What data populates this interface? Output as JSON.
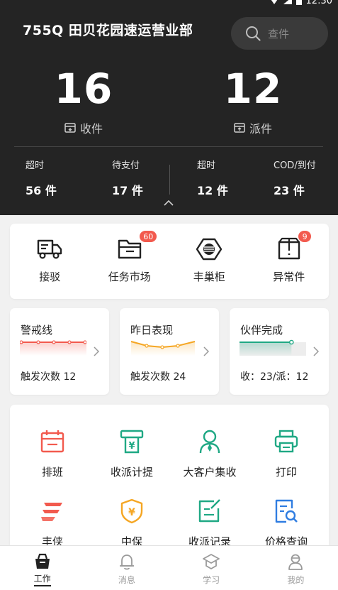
{
  "status_bar": {
    "time": "12:30"
  },
  "header": {
    "station": "755Q 田贝花园速运营业部",
    "search_placeholder": "查件",
    "receive": {
      "count": "16",
      "label": "收件"
    },
    "dispatch": {
      "count": "12",
      "label": "派件"
    },
    "sub_stats": [
      {
        "title": "超时",
        "value": "56 件"
      },
      {
        "title": "待支付",
        "value": "17 件"
      },
      {
        "title": "超时",
        "value": "12 件"
      },
      {
        "title": "COD/到付",
        "value": "23 件"
      }
    ]
  },
  "quick_actions": [
    {
      "label": "接驳",
      "icon": "truck-icon"
    },
    {
      "label": "任务市场",
      "icon": "folder-icon",
      "badge": "60"
    },
    {
      "label": "丰巢柜",
      "icon": "locker-icon"
    },
    {
      "label": "异常件",
      "icon": "exception-box-icon",
      "badge": "9"
    }
  ],
  "metrics": [
    {
      "title": "警戒线",
      "value": "触发次数 12",
      "color": "#f25a4e"
    },
    {
      "title": "昨日表现",
      "value": "触发次数 24",
      "color": "#f5a623"
    },
    {
      "title": "伙伴完成",
      "value": "收：23/派：12",
      "color": "#1fa884",
      "progress": 0.78
    }
  ],
  "tools": [
    {
      "label": "排班",
      "icon": "calendar-icon",
      "color": "#f25a4e"
    },
    {
      "label": "收派计提",
      "icon": "atm-icon",
      "color": "#1fa884"
    },
    {
      "label": "大客户集收",
      "icon": "person-icon",
      "color": "#1fa884"
    },
    {
      "label": "打印",
      "icon": "printer-icon",
      "color": "#1fa884"
    },
    {
      "label": "丰侠",
      "icon": "feng-logo-icon",
      "color": "#f25a4e"
    },
    {
      "label": "中保",
      "icon": "yuan-shield-icon",
      "color": "#f5a623"
    },
    {
      "label": "收派记录",
      "icon": "edit-note-icon",
      "color": "#1fa884"
    },
    {
      "label": "价格查询",
      "icon": "doc-search-icon",
      "color": "#2f7de1"
    }
  ],
  "tabbar": [
    {
      "label": "工作",
      "icon": "work-bag-icon",
      "active": true
    },
    {
      "label": "消息",
      "icon": "bell-icon"
    },
    {
      "label": "学习",
      "icon": "study-icon"
    },
    {
      "label": "我的",
      "icon": "profile-icon"
    }
  ]
}
